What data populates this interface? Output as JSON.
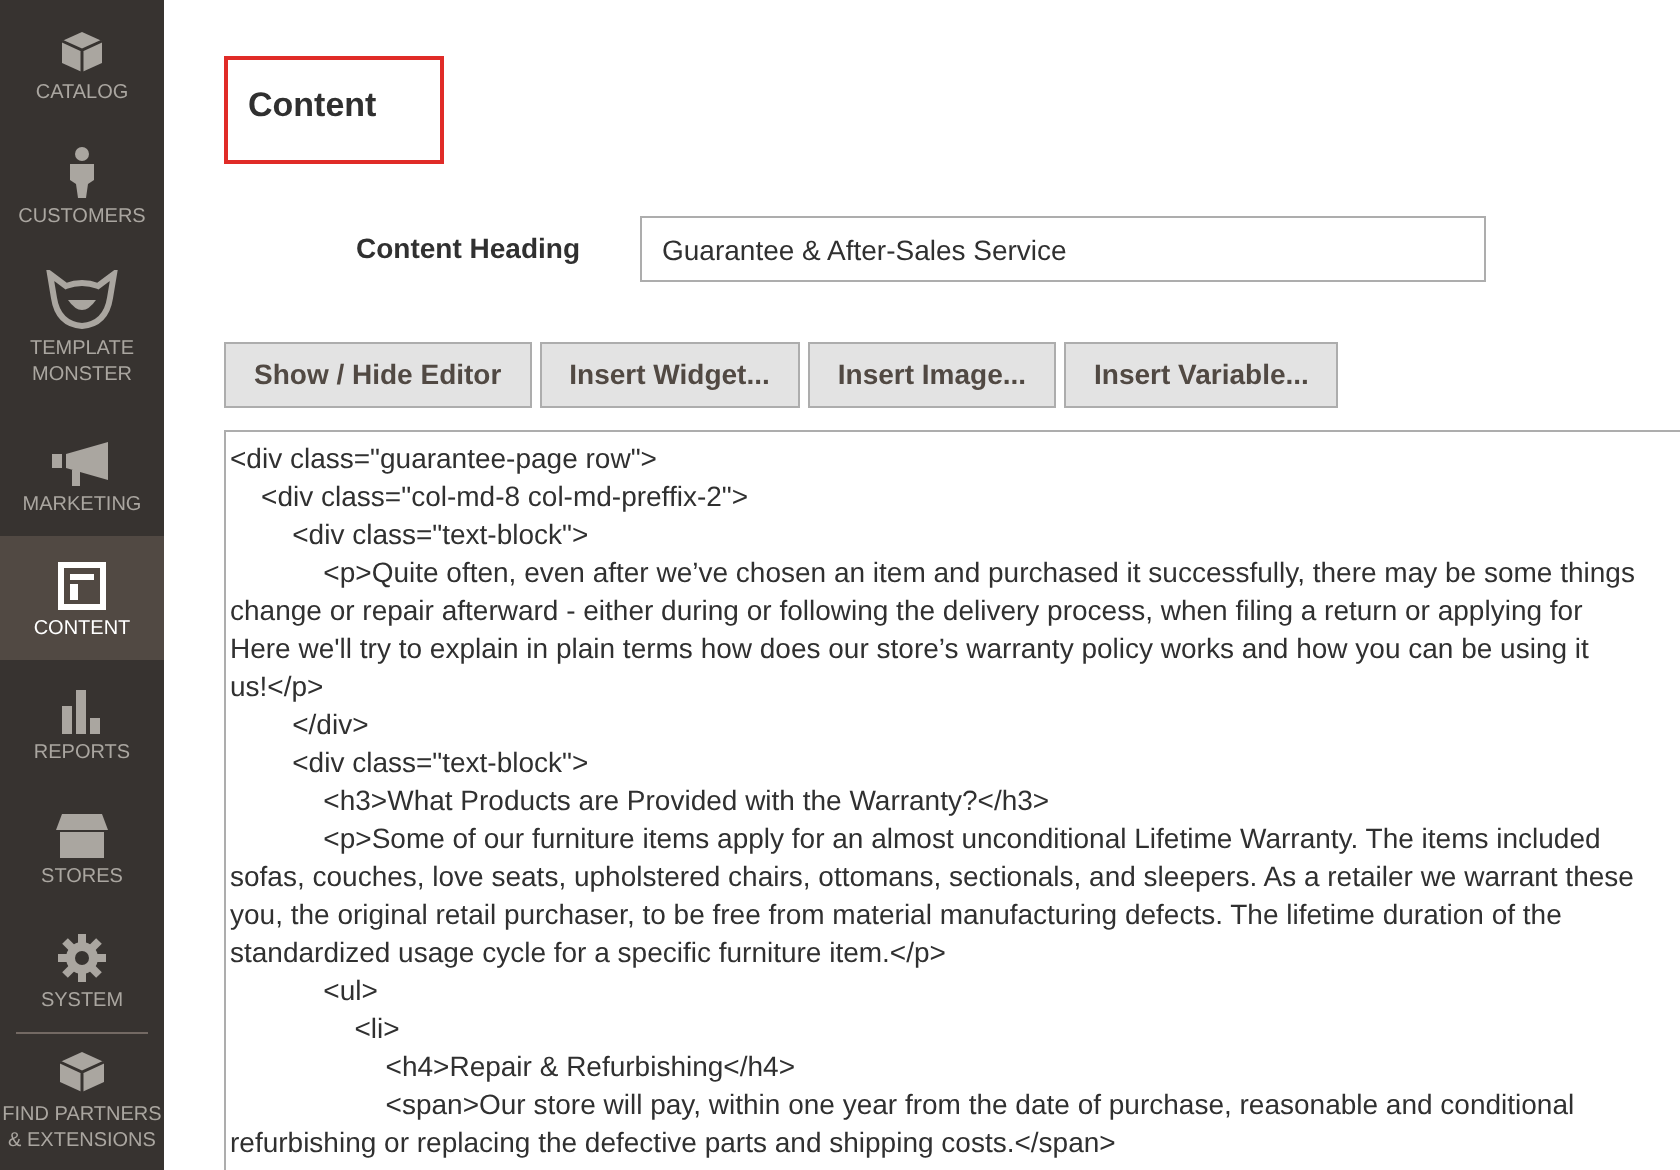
{
  "sidebar": {
    "items": [
      {
        "label": "CATALOG",
        "selected": false
      },
      {
        "label": "CUSTOMERS",
        "selected": false
      },
      {
        "label": "TEMPLATE MONSTER",
        "selected": false
      },
      {
        "label": "MARKETING",
        "selected": false
      },
      {
        "label": "CONTENT",
        "selected": true
      },
      {
        "label": "REPORTS",
        "selected": false
      },
      {
        "label": "STORES",
        "selected": false
      },
      {
        "label": "SYSTEM",
        "selected": false
      },
      {
        "label": "FIND PARTNERS & EXTENSIONS",
        "selected": false
      }
    ]
  },
  "section": {
    "title": "Content",
    "highlighted": true
  },
  "content_heading": {
    "label": "Content Heading",
    "value": "Guarantee & After-Sales Service"
  },
  "buttons": [
    "Show / Hide Editor",
    "Insert Widget...",
    "Insert Image...",
    "Insert Variable..."
  ],
  "editor": {
    "lines": [
      "<div class=\"guarantee-page row\">",
      "    <div class=\"col-md-8 col-md-preffix-2\">",
      "        <div class=\"text-block\">",
      "            <p>Quite often, even after we’ve chosen an item and purchased it successfully, there may be some things",
      "change or repair afterward - either during or following the delivery process, when filing a return or applying for",
      "Here we'll try to explain in plain terms how does our store’s warranty policy works and how you can be using it",
      "us!</p>",
      "        </div>",
      "        <div class=\"text-block\">",
      "            <h3>What Products are Provided with the Warranty?</h3>",
      "            <p>Some of our furniture items apply for an almost unconditional Lifetime Warranty. The items included",
      "sofas, couches, love seats, upholstered chairs, ottomans, sectionals, and sleepers. As a retailer we warrant these",
      "you, the original retail purchaser, to be free from material manufacturing defects. The lifetime duration of the",
      "standardized usage cycle for a specific furniture item.</p>",
      "            <ul>",
      "                <li>",
      "                    <h4>Repair & Refurbishing</h4>",
      "                    <span>Our store will pay, within one year from the date of purchase, reasonable and conditional",
      "refurbishing or replacing the defective parts and shipping costs.</span>"
    ]
  }
}
